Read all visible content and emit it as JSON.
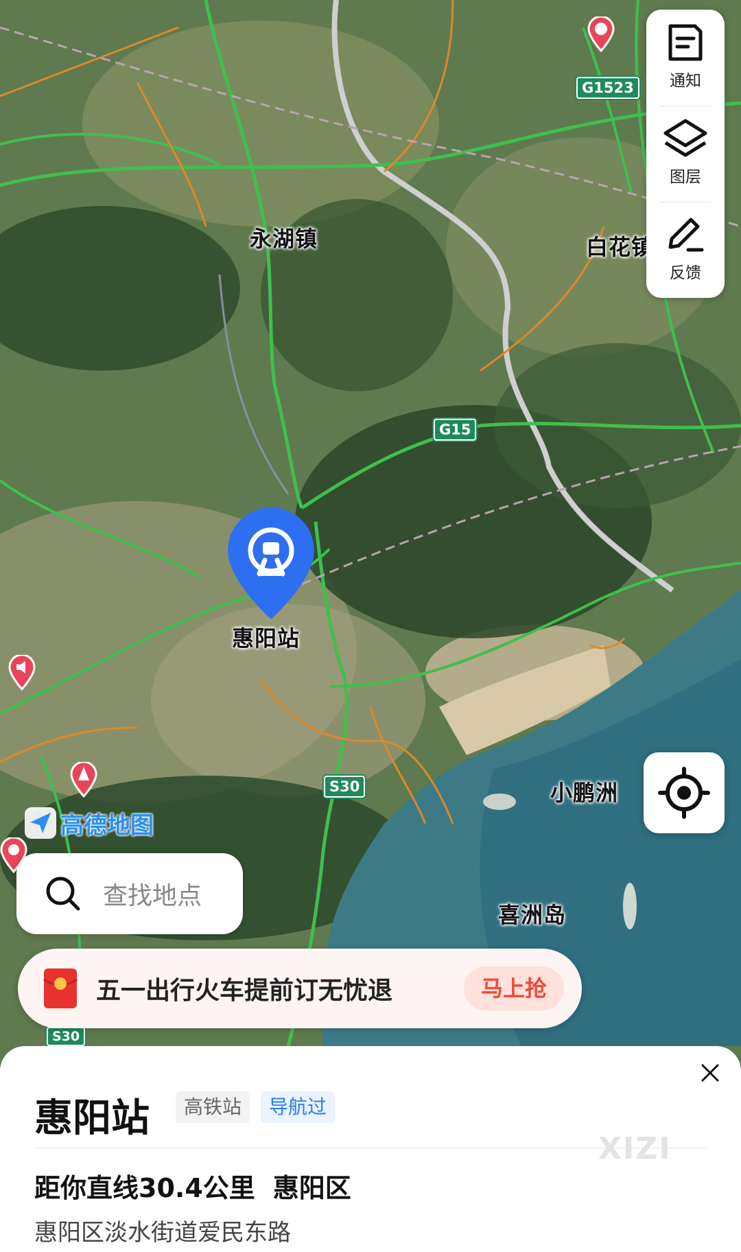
{
  "map": {
    "labels": {
      "town_yonghu": "永湖镇",
      "town_baihua": "白花镇",
      "station": "惠阳站",
      "island_xiaopengzhou": "小鹏洲",
      "island_xizhoudao": "喜洲岛"
    },
    "shields": {
      "g1523": "G1523",
      "g15": "G15",
      "s30_a": "S30",
      "s30_b": "S30"
    },
    "station_pin_icon": "railway-station-icon",
    "colors": {
      "pin_blue": "#2d6ff0",
      "shield_green": "#1f8a5a",
      "road_green": "#3fbf4f",
      "road_orange": "#d98a2a"
    }
  },
  "toolbar": {
    "notify_label": "通知",
    "layers_label": "图层",
    "feedback_label": "反馈"
  },
  "brand": {
    "name": "高德地图"
  },
  "search": {
    "placeholder": "查找地点"
  },
  "promo": {
    "text": "五一出行火车提前订无忧退",
    "button": "马上抢"
  },
  "poi": {
    "name": "惠阳站",
    "tag_type": "高铁站",
    "tag_visited": "导航过",
    "distance": "距你直线30.4公里",
    "district": "惠阳区",
    "address": "惠阳区淡水街道爱民东路",
    "watermark": "XIZI"
  }
}
